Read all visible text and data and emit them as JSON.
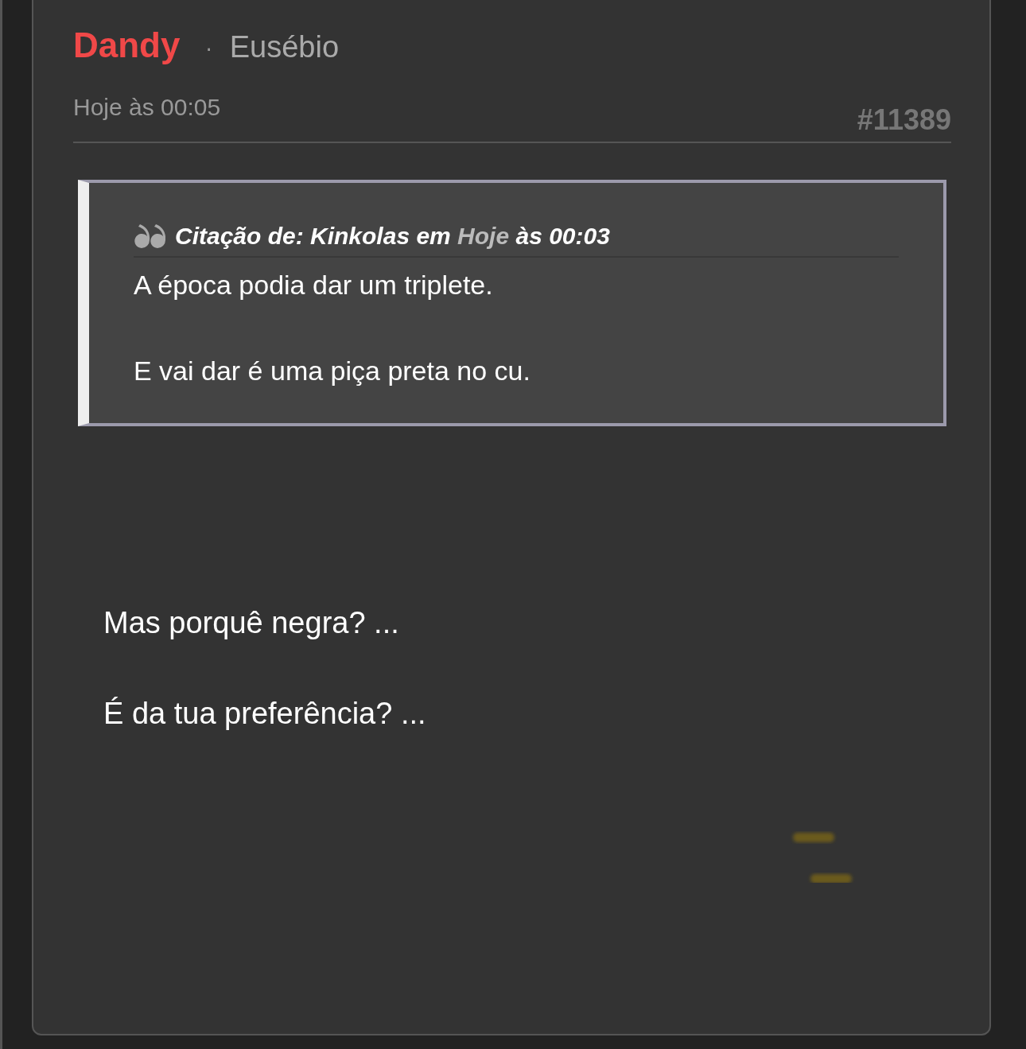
{
  "post": {
    "author": "Dandy",
    "separator": "·",
    "rank": "Eusébio",
    "time": "Hoje às 00:05",
    "number": "#11389",
    "quote": {
      "prefix": "Citação de: Kinkolas em",
      "link": "Hoje",
      "suffix": "às 00:03",
      "paragraphs": [
        "A época podia dar um triplete.",
        "E vai dar é uma piça preta no cu."
      ]
    },
    "paragraphs": [
      "Mas porquê negra? ...",
      "É da tua preferência? ..."
    ]
  }
}
